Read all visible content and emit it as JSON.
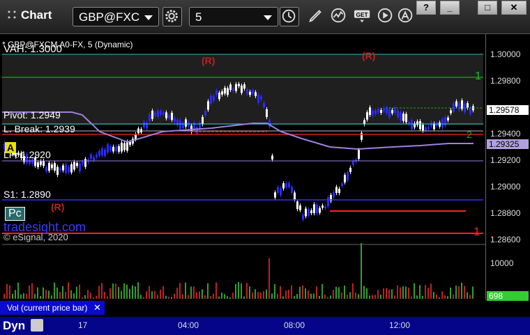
{
  "window": {
    "title": "Chart",
    "buttons": {
      "help": "?",
      "minimize": "_",
      "maximize": "□",
      "close": "✕"
    }
  },
  "toolbar": {
    "symbol": "GBP@FXC",
    "interval": "5",
    "icons": [
      "gear-icon",
      "clock-icon",
      "pencil-icon",
      "line-study-icon",
      "get-icon",
      "play-icon",
      "alert-icon"
    ],
    "get_label": "GET"
  },
  "chart": {
    "legend": "* GBP@FXCM A0-FX, 5 (Dynamic)",
    "labels": {
      "vah": "VAH: 1.3000",
      "pivot": "Pivot: 1.2949",
      "lbreak": "L. Break: 1.2939",
      "lp": "LP: 1.2920",
      "s1": "S1: 1.2890",
      "a": "A",
      "pc": "Pc",
      "r1": "(R)",
      "r2": "(R)",
      "r3": "(R)",
      "n1": "1",
      "n2": "1",
      "n3": "2",
      "watermark": "tradesight.com",
      "copyright": "© eSignal, 2020"
    },
    "y_ticks": [
      "1.30000",
      "1.29800",
      "1.29600",
      "1.29400",
      "1.29200",
      "1.29000",
      "1.28800",
      "1.28600"
    ],
    "current_price": "1.29578",
    "ma_value": "1.29325",
    "volume_tick": "10000",
    "volume_value": "698",
    "x_ticks": [
      "17",
      "04:00",
      "08:00",
      "12:00"
    ],
    "volume_label": "Vol (current price bar)",
    "bottom_label": "Dyn"
  },
  "colors": {
    "up_candle": "#ffffff",
    "down_candle": "#2a2aff",
    "current_price_bg": "#ffffff",
    "ma_bg": "#b0a0e0",
    "volume_up": "#2fa02f",
    "volume_down": "#c02020",
    "volume_badge": "#33cc33"
  }
}
